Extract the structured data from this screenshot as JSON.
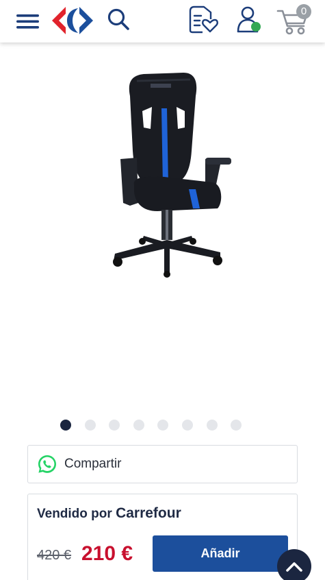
{
  "header": {
    "icons": [
      "menu-icon",
      "carrefour-logo",
      "search-icon",
      "shopping-list-icon",
      "user-icon",
      "cart-icon"
    ],
    "cart_count": "0",
    "colors": {
      "navy": "#1c3d7a",
      "brand_red": "#e1232c",
      "brand_blue": "#1c4f9c",
      "status_green": "#34a853"
    }
  },
  "carousel": {
    "image": "gaming-chair-image",
    "total_images": 8,
    "active_index": 0
  },
  "share": {
    "label": "Compartir",
    "icon": "whatsapp-icon"
  },
  "seller": {
    "prefix": "Vendido por",
    "name": "Carrefour"
  },
  "price": {
    "old": "420 €",
    "current": "210 €",
    "current_color": "#c8102e"
  },
  "actions": {
    "add_label": "Añadir",
    "scroll_top_icon": "chevron-up-icon"
  }
}
